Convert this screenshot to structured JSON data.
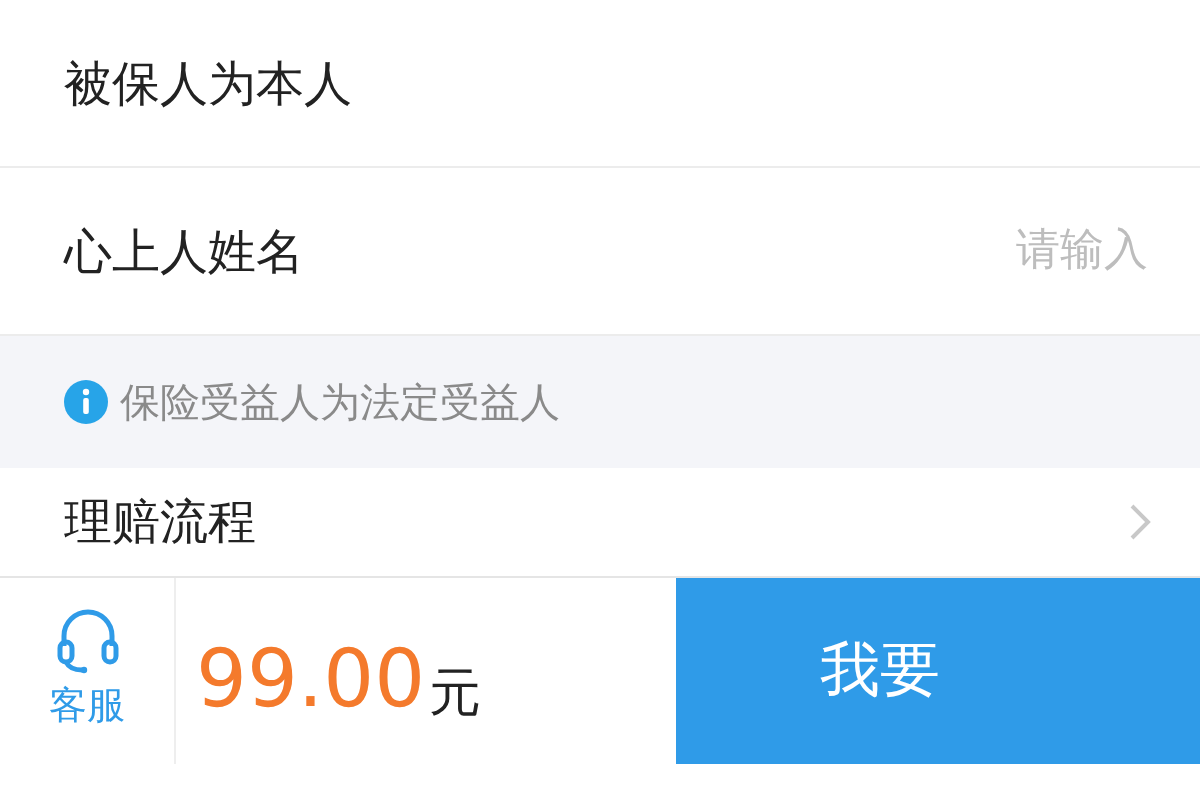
{
  "form_rows": [
    {
      "kind": "static",
      "label": "被保人为本人"
    },
    {
      "kind": "input",
      "label": "心上人姓名",
      "placeholder": "请输入"
    }
  ],
  "notice": {
    "text": "保险受益人为法定受益人"
  },
  "link_row": {
    "label": "理赔流程"
  },
  "bottom_bar": {
    "service_label": "客服",
    "price": "99.00",
    "currency": "元",
    "action_button": "我要"
  }
}
